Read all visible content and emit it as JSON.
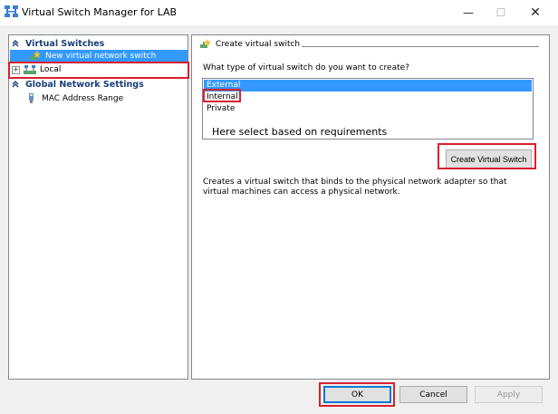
{
  "window": {
    "title": "Virtual Switch Manager for LAB",
    "controls": {
      "minimize": "—",
      "maximize": "☐",
      "close": "✕"
    }
  },
  "tree": {
    "virtual_switches_header": "Virtual Switches",
    "new_switch": "New virtual network switch",
    "local": "Local",
    "expander": "+",
    "global_header": "Global Network Settings",
    "mac_range": "MAC Address Range"
  },
  "panel": {
    "group_title": "Create virtual switch",
    "question": "What type of virtual switch do you want to create?",
    "switch_types": [
      "External",
      "Internal",
      "Private"
    ],
    "selected_type": "External",
    "note": "Here select based on requirements",
    "create_button": "Create Virtual Switch",
    "description": "Creates a virtual switch that binds to the physical network adapter so that virtual machines can access a physical network."
  },
  "footer": {
    "ok": "OK",
    "cancel": "Cancel",
    "apply": "Apply"
  },
  "colors": {
    "selection": "#3399ff",
    "highlight": "#d9202f",
    "header_text": "#1a3f7a"
  }
}
